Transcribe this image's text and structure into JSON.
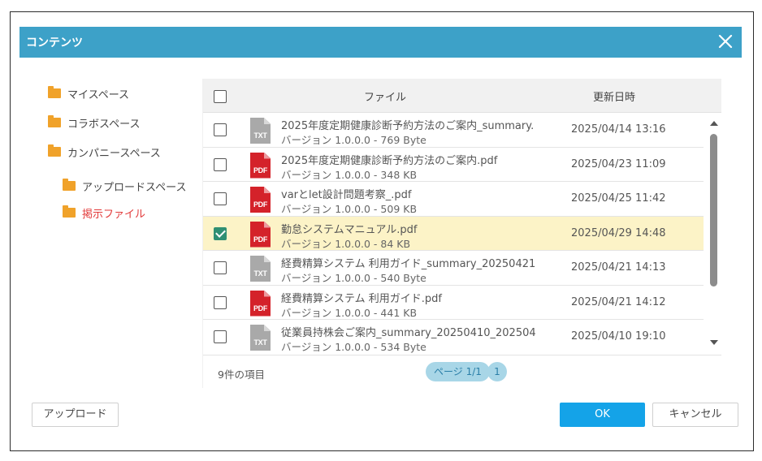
{
  "dialog": {
    "title": "コンテンツ"
  },
  "tree": {
    "items": [
      {
        "label": "マイスペース"
      },
      {
        "label": "コラボスペース"
      },
      {
        "label": "カンパニースペース"
      },
      {
        "label": "アップロードスペース"
      },
      {
        "label": "掲示ファイル",
        "active": true
      }
    ]
  },
  "table": {
    "columns": {
      "file": "ファイル",
      "updated": "更新日時"
    },
    "rows": [
      {
        "type": "TXT",
        "name": "2025年度定期健康診断予約方法のご案内_summary.",
        "meta": "バージョン 1.0.0.0 - 769 Byte",
        "date": "2025/04/14 13:16",
        "checked": false
      },
      {
        "type": "PDF",
        "name": "2025年度定期健康診断予約方法のご案内.pdf",
        "meta": "バージョン 1.0.0.0 - 348 KB",
        "date": "2025/04/23 11:09",
        "checked": false
      },
      {
        "type": "PDF",
        "name": "varとlet設計問題考察_.pdf",
        "meta": "バージョン 1.0.0.0 - 509 KB",
        "date": "2025/04/25 11:42",
        "checked": false
      },
      {
        "type": "PDF",
        "name": "勤怠システムマニュアル.pdf",
        "meta": "バージョン 1.0.0.0 - 84 KB",
        "date": "2025/04/29 14:48",
        "checked": true
      },
      {
        "type": "TXT",
        "name": "経費精算システム 利用ガイド_summary_20250421",
        "meta": "バージョン 1.0.0.0 - 540 Byte",
        "date": "2025/04/21 14:13",
        "checked": false
      },
      {
        "type": "PDF",
        "name": "経費精算システム 利用ガイド.pdf",
        "meta": "バージョン 1.0.0.0 - 441 KB",
        "date": "2025/04/21 14:12",
        "checked": false
      },
      {
        "type": "TXT",
        "name": "従業員持株会ご案内_summary_20250410_202504",
        "meta": "バージョン 1.0.0.0 - 534 Byte",
        "date": "2025/04/10 19:10",
        "checked": false
      }
    ]
  },
  "footer": {
    "count": "9件の項目",
    "page_label": "ページ 1/1",
    "page_number": "1"
  },
  "buttons": {
    "upload": "アップロード",
    "ok": "OK",
    "cancel": "キャンセル"
  },
  "colors": {
    "titlebar": "#3da1c8",
    "folder": "#f0a22a",
    "active_tree": "#e23a3a",
    "selected_row": "#fcf3c7",
    "checkbox_checked": "#2f8f73",
    "ok_button": "#14a3e8",
    "pdf_icon": "#d4222a",
    "txt_icon": "#a9a9a9"
  },
  "icons": {
    "close": "close-icon",
    "folder": "folder-icon",
    "pdf": "pdf-file-icon",
    "txt": "txt-file-icon"
  }
}
